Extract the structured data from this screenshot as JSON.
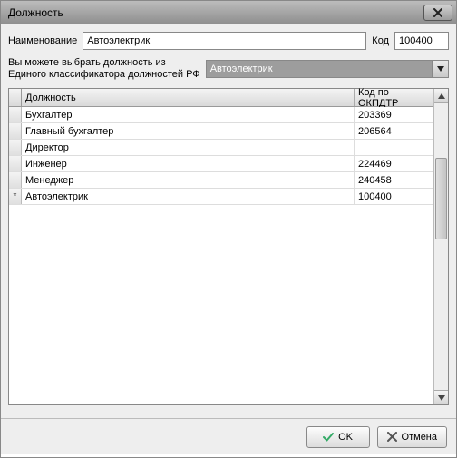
{
  "window": {
    "title": "Должность"
  },
  "form": {
    "name_label": "Наименование",
    "name_value": "Автоэлектрик",
    "code_label": "Код",
    "code_value": "100400",
    "hint_line1": "Вы можете выбрать должность из",
    "hint_line2": "Единого классификатора должностей РФ",
    "combo_value": "Автоэлектрик"
  },
  "grid": {
    "col1": "Должность",
    "col2": "Код по ОКПДТР",
    "rows": [
      {
        "name": "Бухгалтер",
        "code": "203369",
        "marker": ""
      },
      {
        "name": "Главный бухгалтер",
        "code": "206564",
        "marker": ""
      },
      {
        "name": "Директор",
        "code": "",
        "marker": ""
      },
      {
        "name": "Инженер",
        "code": "224469",
        "marker": ""
      },
      {
        "name": "Менеджер",
        "code": "240458",
        "marker": ""
      },
      {
        "name": "Автоэлектрик",
        "code": "100400",
        "marker": "*"
      }
    ]
  },
  "buttons": {
    "ok": "OK",
    "cancel": "Отмена"
  }
}
